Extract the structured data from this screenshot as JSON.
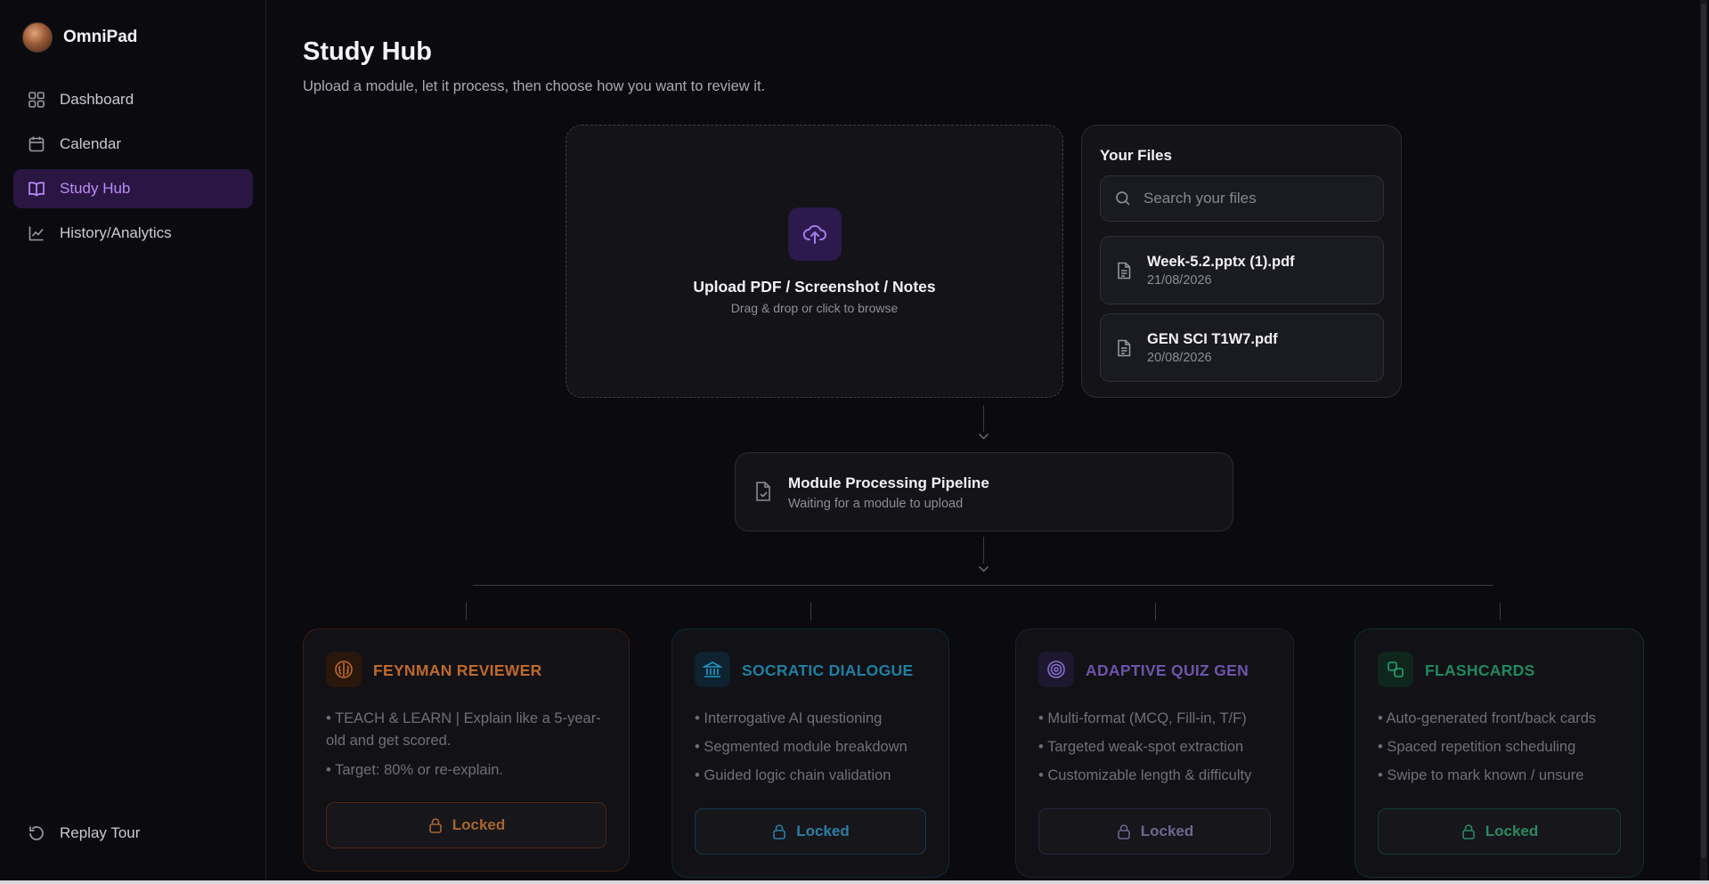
{
  "app": {
    "name": "OmniPad"
  },
  "sidebar": {
    "items": [
      {
        "label": "Dashboard",
        "icon": "grid-icon"
      },
      {
        "label": "Calendar",
        "icon": "calendar-icon"
      },
      {
        "label": "Study Hub",
        "icon": "book-open-icon",
        "active": true
      },
      {
        "label": "History/Analytics",
        "icon": "line-chart-icon"
      }
    ],
    "replay_label": "Replay Tour"
  },
  "header": {
    "title": "Study Hub",
    "subtitle": "Upload a module, let it process, then choose how you want to review it."
  },
  "upload": {
    "title": "Upload PDF / Screenshot / Notes",
    "hint": "Drag & drop or click to browse"
  },
  "files": {
    "title": "Your Files",
    "search_placeholder": "Search your files",
    "items": [
      {
        "name": "Week-5.2.pptx (1).pdf",
        "date": "21/08/2026"
      },
      {
        "name": "GEN SCI T1W7.pdf",
        "date": "20/08/2026"
      }
    ]
  },
  "pipeline": {
    "title": "Module Processing Pipeline",
    "status": "Waiting for a module to upload"
  },
  "modes": [
    {
      "title": "FEYNMAN REVIEWER",
      "color": "#c0692a",
      "bullets": [
        "• TEACH & LEARN | Explain like a 5-year-old and get scored.",
        "• Target: 80% or re-explain."
      ],
      "button": "Locked"
    },
    {
      "title": "SOCRATIC DIALOGUE",
      "color": "#1f7fa0",
      "bullets": [
        "• Interrogative AI questioning",
        "• Segmented module breakdown",
        "• Guided logic chain validation"
      ],
      "button": "Locked"
    },
    {
      "title": "ADAPTIVE QUIZ GEN",
      "color": "#6c55a8",
      "bullets": [
        "• Multi-format (MCQ, Fill-in, T/F)",
        "• Targeted weak-spot extraction",
        "• Customizable length & difficulty"
      ],
      "button": "Locked"
    },
    {
      "title": "FLASHCARDS",
      "color": "#1f8a5e",
      "bullets": [
        "• Auto-generated front/back cards",
        "• Spaced repetition scheduling",
        "• Swipe to mark known / unsure"
      ],
      "button": "Locked"
    }
  ]
}
